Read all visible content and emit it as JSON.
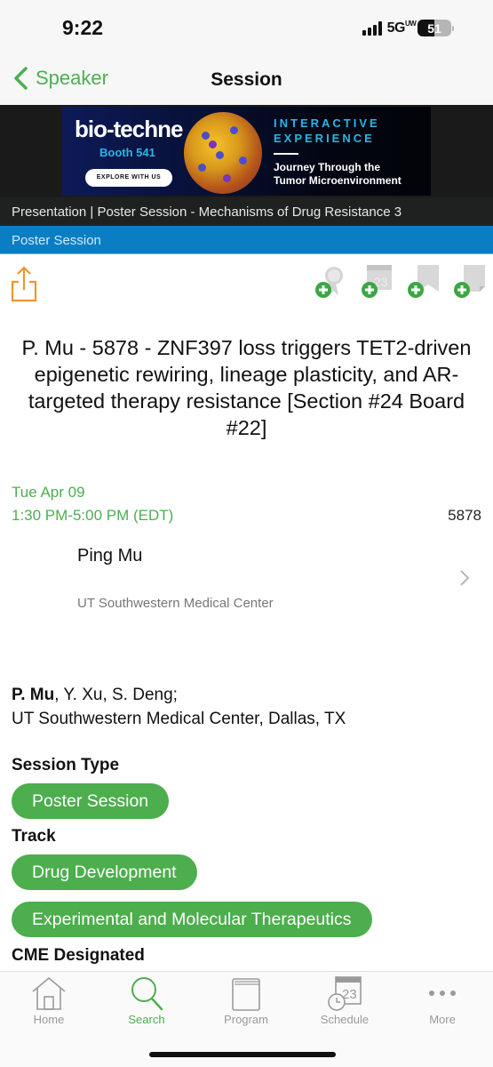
{
  "status_bar": {
    "time": "9:22",
    "network": "5G",
    "network_suffix": "UW",
    "battery_level": "51",
    "battery_fraction": 0.51,
    "signal_bars": 4
  },
  "nav": {
    "back_label": "Speaker",
    "title": "Session",
    "accent_color": "#4caf50"
  },
  "ad": {
    "brand": "bio-techne",
    "booth": "Booth 541",
    "cta": "EXPLORE WITH US",
    "headline_line1": "INTERACTIVE",
    "headline_line2": "EXPERIENCE",
    "sub_line1": "Journey Through the",
    "sub_line2": "Tumor Microenvironment"
  },
  "breadcrumb": "Presentation | Poster Session - Mechanisms of Drug Resistance 3",
  "session_type_bar": "Poster Session",
  "actions": {
    "share": "share-icon",
    "add_items": [
      {
        "icon": "award-ribbon-icon",
        "label": "Add to favorites"
      },
      {
        "icon": "calendar-icon",
        "label": "Add to schedule"
      },
      {
        "icon": "bookmark-icon",
        "label": "Add bookmark"
      },
      {
        "icon": "note-icon",
        "label": "Add note"
      }
    ]
  },
  "presentation": {
    "title": "P. Mu - 5878 - ZNF397 loss triggers TET2-driven epigenetic rewiring, lineage plasticity, and AR-targeted therapy resistance [Section #24 Board #22]",
    "date": "Tue Apr 09",
    "time": "1:30 PM-5:00 PM (EDT)",
    "abstract_number": "5878"
  },
  "speaker": {
    "name": "Ping Mu",
    "institution": "UT Southwestern Medical Center"
  },
  "authors": {
    "presenting": "P. Mu",
    "others": ", Y. Xu, S. Deng;",
    "affiliation": "UT Southwestern Medical Center, Dallas, TX"
  },
  "details": {
    "session_type_label": "Session Type",
    "session_type": "Poster Session",
    "track_label": "Track",
    "tracks": [
      "Drug Development",
      "Experimental and Molecular Therapeutics"
    ],
    "cme_label": "CME Designated"
  },
  "tab_bar": {
    "tabs": [
      {
        "label": "Home",
        "icon": "home-icon",
        "active": false
      },
      {
        "label": "Search",
        "icon": "search-icon",
        "active": true
      },
      {
        "label": "Program",
        "icon": "book-icon",
        "active": false
      },
      {
        "label": "Schedule",
        "icon": "schedule-icon",
        "active": false
      },
      {
        "label": "More",
        "icon": "more-icon",
        "active": false
      }
    ]
  }
}
